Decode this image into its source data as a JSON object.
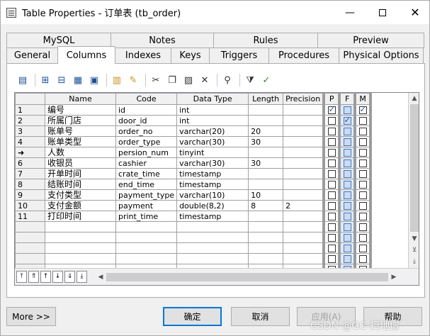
{
  "window": {
    "title": "Table Properties - 订单表 (tb_order)",
    "minimize": "—",
    "close": "✕"
  },
  "tabs_row1": [
    "MySQL",
    "Notes",
    "Rules",
    "Preview"
  ],
  "tabs_row2": [
    "General",
    "Columns",
    "Indexes",
    "Keys",
    "Triggers",
    "Procedures",
    "Physical Options"
  ],
  "active_tab": "Columns",
  "toolbar": [
    "properties-icon",
    "insert-row-icon",
    "add-row-icon",
    "add-columns-icon",
    "copy-columns-icon",
    "domain-icon",
    "find-icon",
    "cut-icon",
    "copy-icon",
    "paste-icon",
    "delete-icon",
    "find-binoculars-icon",
    "filter-icon",
    "customize-columns-icon"
  ],
  "grid": {
    "headers": [
      "Name",
      "Code",
      "Data Type",
      "Length",
      "Precision",
      "P",
      "F",
      "M"
    ],
    "rows": [
      {
        "num": "1",
        "name": "编号",
        "code": "id",
        "type": "int",
        "length": "",
        "precision": "",
        "p": true,
        "f": false,
        "m": true
      },
      {
        "num": "2",
        "name": "所属门店",
        "code": "door_id",
        "type": "int",
        "length": "",
        "precision": "",
        "p": false,
        "f": true,
        "m": false
      },
      {
        "num": "3",
        "name": "账单号",
        "code": "order_no",
        "type": "varchar(20)",
        "length": "20",
        "precision": "",
        "p": false,
        "f": false,
        "m": false
      },
      {
        "num": "4",
        "name": "账单类型",
        "code": "order_type",
        "type": "varchar(30)",
        "length": "30",
        "precision": "",
        "p": false,
        "f": false,
        "m": false
      },
      {
        "num": "➜",
        "name": "人数",
        "code": "persion_num",
        "type": "tinyint",
        "length": "",
        "precision": "",
        "p": false,
        "f": false,
        "m": false
      },
      {
        "num": "6",
        "name": "收银员",
        "code": "cashier",
        "type": "varchar(30)",
        "length": "30",
        "precision": "",
        "p": false,
        "f": false,
        "m": false
      },
      {
        "num": "7",
        "name": "开单时间",
        "code": "crate_time",
        "type": "timestamp",
        "length": "",
        "precision": "",
        "p": false,
        "f": false,
        "m": false
      },
      {
        "num": "8",
        "name": "结账时间",
        "code": "end_time",
        "type": "timestamp",
        "length": "",
        "precision": "",
        "p": false,
        "f": false,
        "m": false
      },
      {
        "num": "9",
        "name": "支付类型",
        "code": "payment_type",
        "type": "varchar(10)",
        "length": "10",
        "precision": "",
        "p": false,
        "f": false,
        "m": false
      },
      {
        "num": "10",
        "name": "支付金额",
        "code": "payment",
        "type": "double(8,2)",
        "length": "8",
        "precision": "2",
        "p": false,
        "f": false,
        "m": false
      },
      {
        "num": "11",
        "name": "打印时间",
        "code": "print_time",
        "type": "timestamp",
        "length": "",
        "precision": "",
        "p": false,
        "f": false,
        "m": false
      }
    ],
    "empty_rows": 5
  },
  "nav_buttons": [
    "⤒",
    "⇑",
    "↑",
    "↓",
    "⇓",
    "⤓"
  ],
  "buttons": {
    "more": "More >>",
    "ok": "确定",
    "cancel": "取消",
    "apply": "应用(A)",
    "help": "帮助"
  },
  "watermark": "CSDN @GC-扫地僧"
}
